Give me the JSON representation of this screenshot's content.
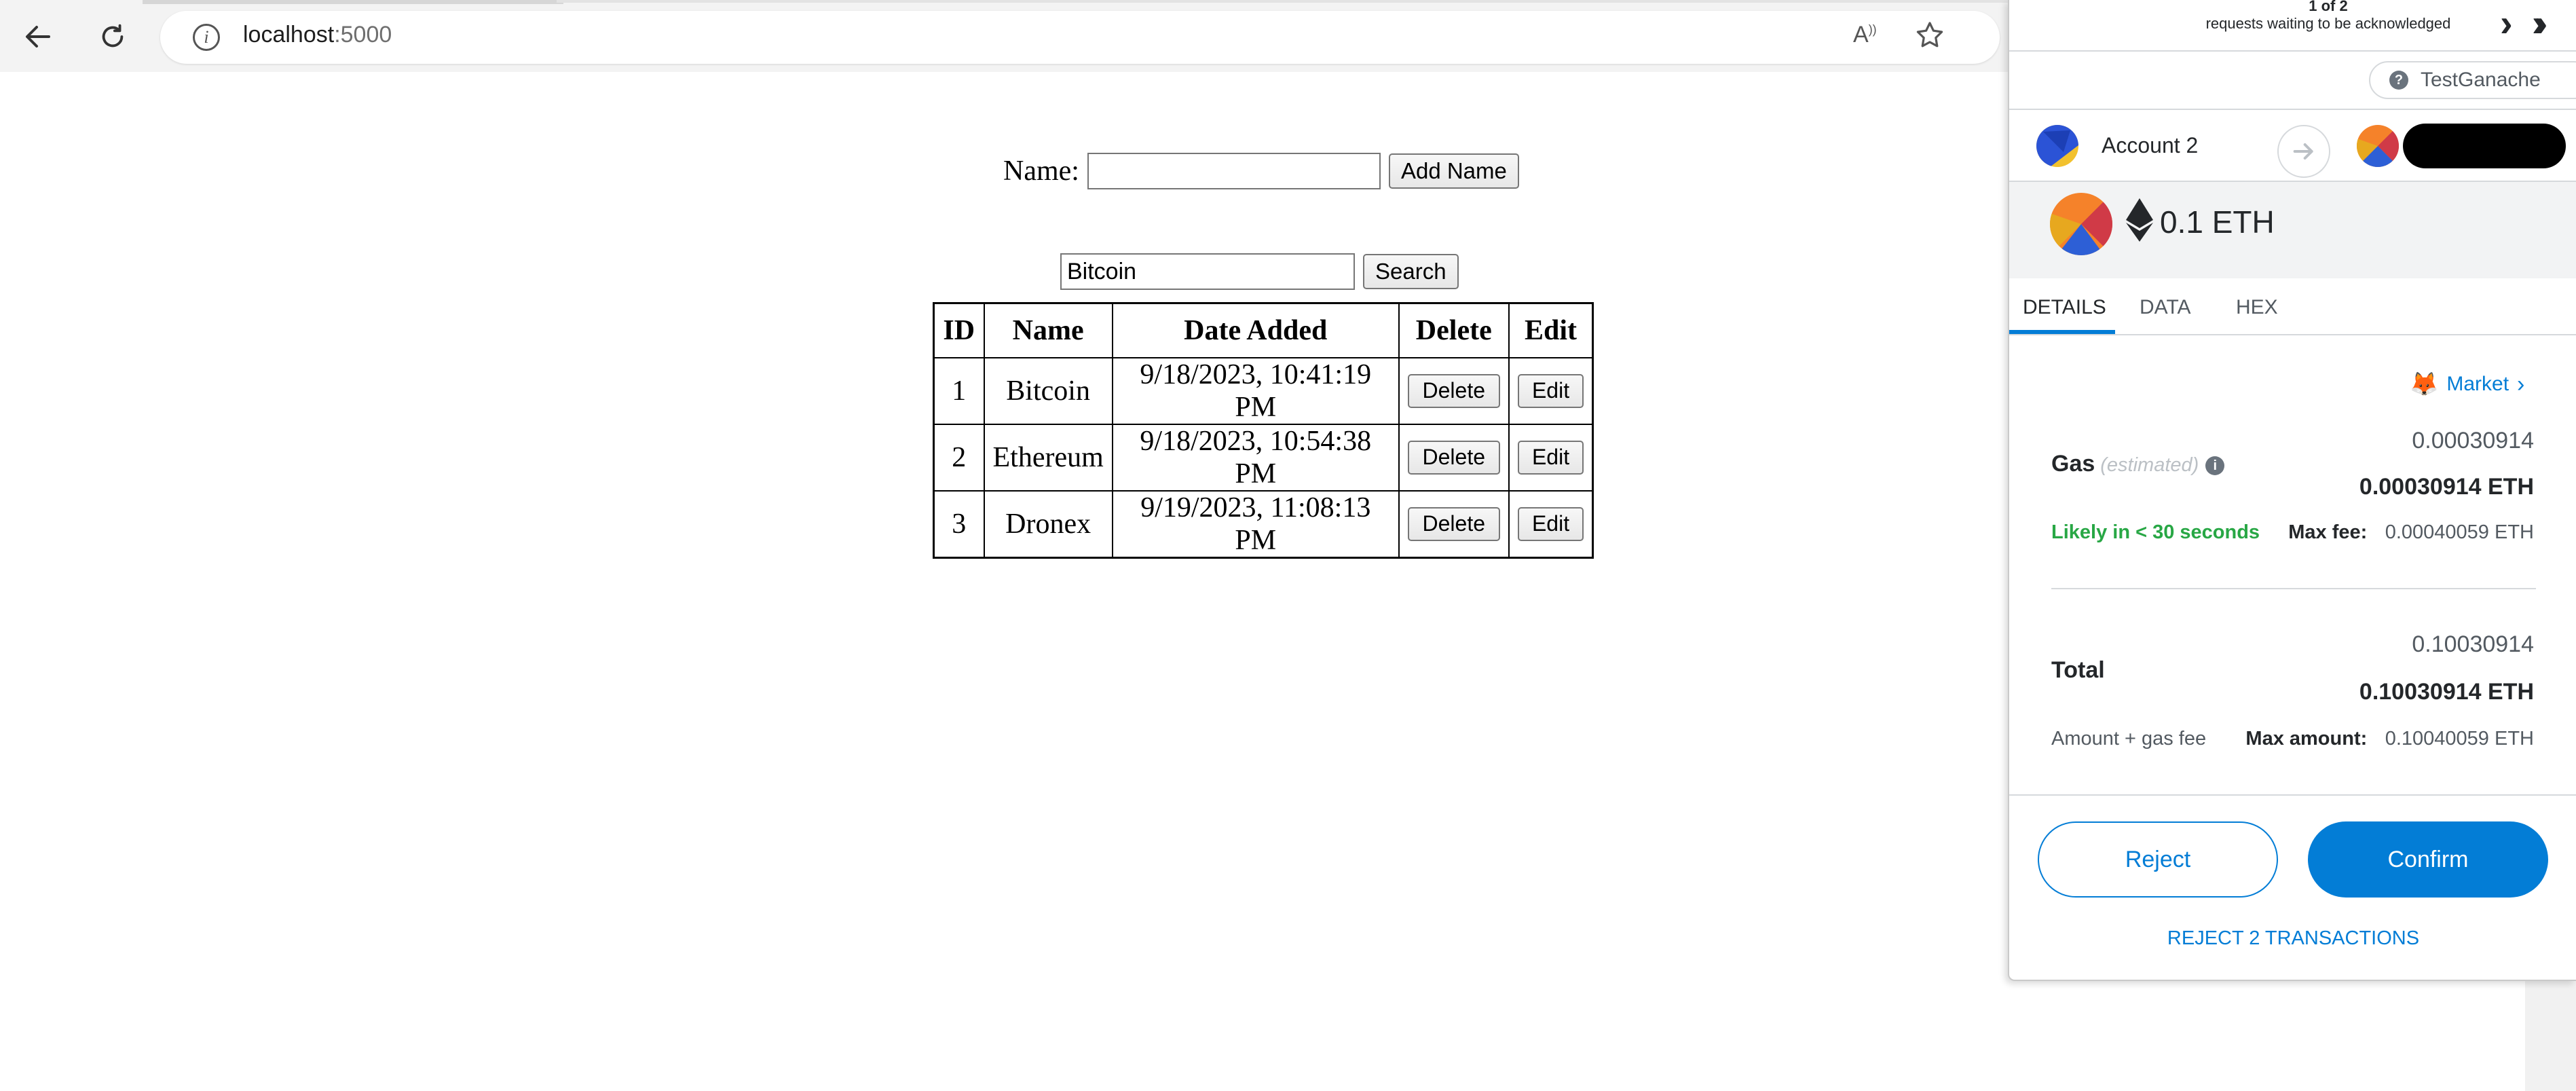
{
  "browser": {
    "url_host": "localhost",
    "url_port": ":5000",
    "icons": [
      "back-arrow-icon",
      "refresh-icon",
      "site-info-icon",
      "read-aloud-icon",
      "favorite-star-icon"
    ]
  },
  "page": {
    "name_label": "Name:",
    "name_input_value": "",
    "add_name_button": "Add Name",
    "search_input_value": "Bitcoin",
    "search_button": "Search",
    "table": {
      "headers": [
        "ID",
        "Name",
        "Date Added",
        "Delete",
        "Edit"
      ],
      "rows": [
        {
          "id": "1",
          "name": "Bitcoin",
          "date": "9/18/2023, 10:41:19 PM",
          "delete": "Delete",
          "edit": "Edit"
        },
        {
          "id": "2",
          "name": "Ethereum",
          "date": "9/18/2023, 10:54:38 PM",
          "delete": "Delete",
          "edit": "Edit"
        },
        {
          "id": "3",
          "name": "Dronex",
          "date": "9/19/2023, 11:08:13 PM",
          "delete": "Delete",
          "edit": "Edit"
        }
      ]
    }
  },
  "metamask": {
    "queue_count": "1 of 2",
    "queue_text": "requests waiting to be acknowledged",
    "network": "TestGanache",
    "network_badge": "?",
    "from_account": "Account 2",
    "amount": "0.1 ETH",
    "tabs": [
      "DETAILS",
      "DATA",
      "HEX"
    ],
    "market": "Market",
    "gas_label": "Gas",
    "gas_estimated": "(estimated)",
    "gas_value": "0.00030914",
    "gas_value_eth": "0.00030914 ETH",
    "likely": "Likely in < 30 seconds",
    "max_fee_label": "Max fee:",
    "max_fee_value": "0.00040059 ETH",
    "total_label": "Total",
    "total_value": "0.10030914",
    "total_value_eth": "0.10030914 ETH",
    "amount_gas_label": "Amount + gas fee",
    "max_amount_label": "Max amount:",
    "max_amount_value": "0.10040059 ETH",
    "reject_button": "Reject",
    "confirm_button": "Confirm",
    "reject_all": "REJECT 2 TRANSACTIONS",
    "colors": {
      "accent": "#037dd6",
      "success": "#28a745"
    }
  }
}
